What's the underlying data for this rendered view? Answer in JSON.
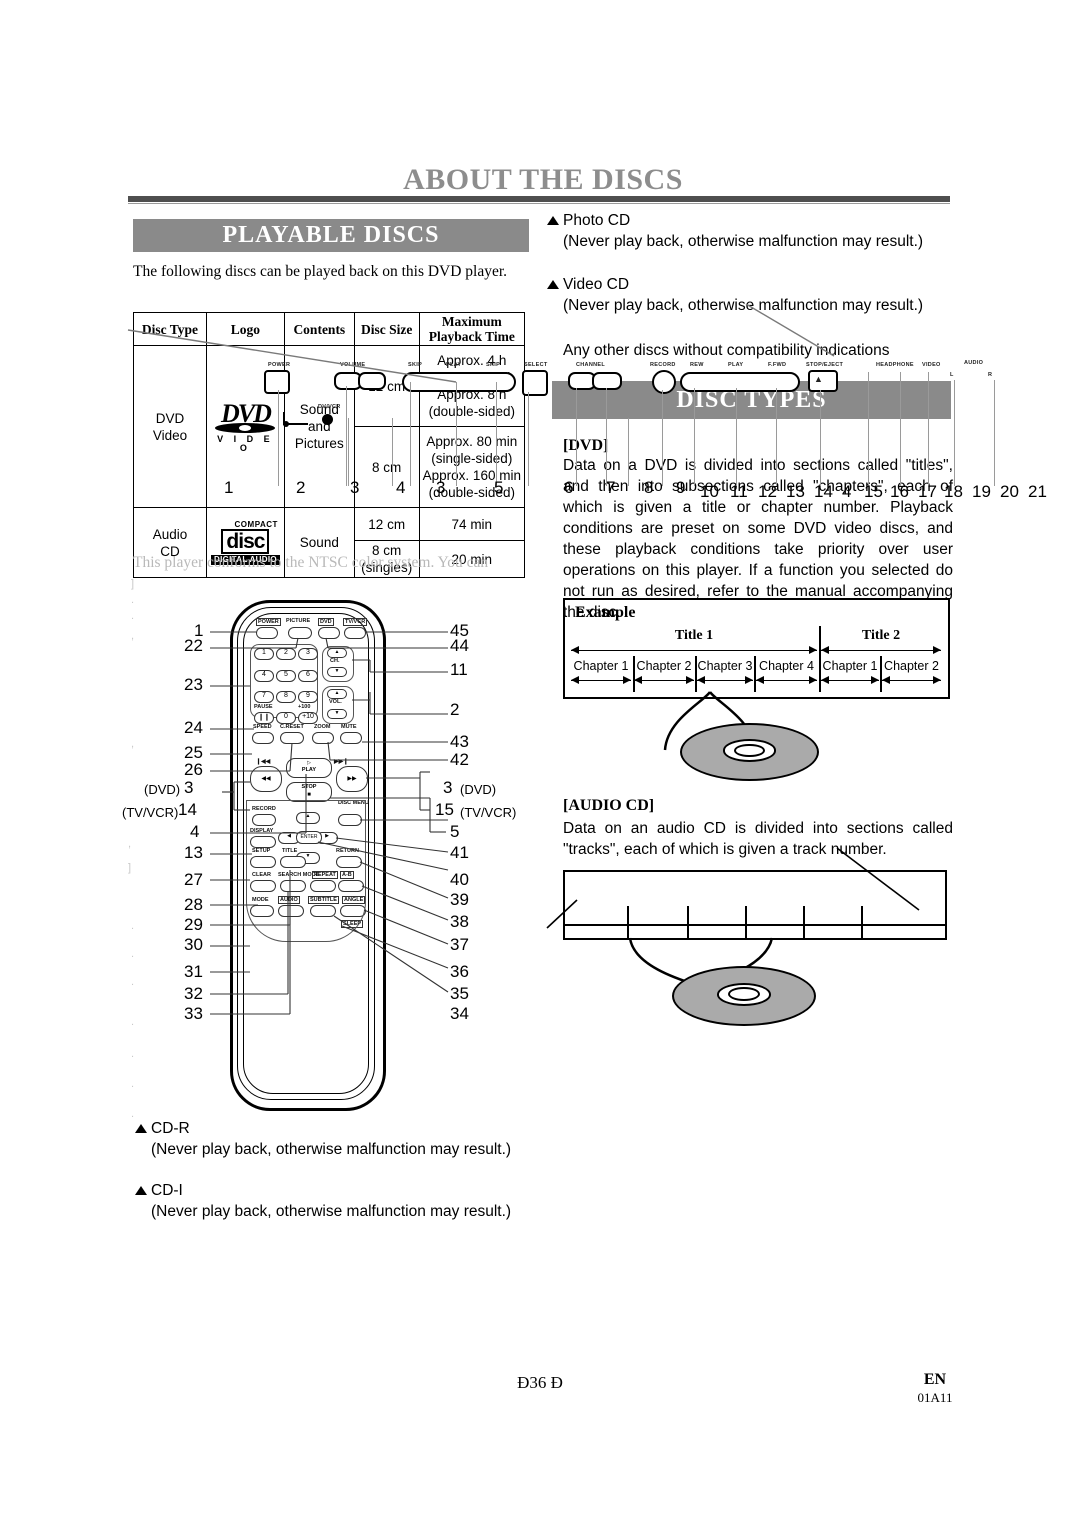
{
  "header": {
    "title": "ABOUT THE DISCS"
  },
  "banners": {
    "playable_discs": "PLAYABLE DISCS",
    "disc_types": "DISC TYPES"
  },
  "left": {
    "intro": "The following discs can be played back on this DVD player.",
    "table": {
      "columns": [
        "Disc Type",
        "Logo",
        "Contents",
        "Disc Size",
        "Maximum Playback Time"
      ],
      "column_maximum_line1": "Maximum",
      "column_maximum_line2": "Playback Time",
      "rows": [
        {
          "disc_type": "DVD Video",
          "logo": "dvd-video-logo",
          "logo_text_main": "DVD",
          "logo_text_sub": "V I D E O",
          "contents": "Sound and Pictures",
          "sizes": [
            {
              "size": "12 cm",
              "time": "Approx. 4 h (single-sided) Approx. 8 h (double-sided)"
            },
            {
              "size": "8 cm",
              "time": "Approx. 80 min (single-sided) Approx. 160 min (double-sided)"
            }
          ]
        },
        {
          "disc_type": "Audio CD",
          "logo": "compact-disc-digital-audio-logo",
          "logo_text_top": "COMPACT",
          "logo_text_main": "disc",
          "logo_text_bottom": "DIGITAL AUDIO",
          "contents": "Sound",
          "sizes": [
            {
              "size": "12 cm",
              "time": "74 min"
            },
            {
              "size": "8 cm (singles)",
              "time": "20 min"
            }
          ]
        }
      ]
    },
    "ntsc_note": "This player conforms to the NTSC color system. You can",
    "cdr": {
      "heading": "CD-R",
      "body": "(Never play back, otherwise malfunction may result.)"
    },
    "cdi": {
      "heading": "CD-I",
      "body": "(Never play back, otherwise malfunction may result.)"
    }
  },
  "right": {
    "photo_cd": {
      "heading": "Photo CD",
      "body": "(Never play back, otherwise malfunction may result.)"
    },
    "video_cd": {
      "heading": "Video CD",
      "body": "(Never play back, otherwise malfunction may result.)"
    },
    "any_other": "Any other discs without compatibility indications",
    "dvd": {
      "heading": "[DVD]",
      "body": "Data on a DVD is divided into sections called \"titles\", and then into subsections called \"chapters\", each of which is given a title or chapter number. Playback conditions are preset on some DVD video discs, and these playback conditions take priority over user operations on this player. If a function you selected do not run as desired, refer to the manual accompanying the disc."
    },
    "example": {
      "label": "Example",
      "titles": [
        {
          "name": "Title 1",
          "chapters": [
            "Chapter 1",
            "Chapter 2",
            "Chapter 3",
            "Chapter 4"
          ]
        },
        {
          "name": "Title 2",
          "chapters": [
            "Chapter 1",
            "Chapter 2"
          ]
        }
      ]
    },
    "audio_cd": {
      "heading": "[AUDIO CD]",
      "body": "Data on an audio CD is divided into sections called \"tracks\", each of which is given a track number."
    }
  },
  "footer": {
    "page": "Ð36 Ð",
    "lang": "EN",
    "code": "01A11"
  },
  "panel_overlay": {
    "labels": [
      "POWER",
      "VOLUME",
      "SKIP",
      "PLAY",
      "SKIP",
      "SELECT",
      "CHANNEL",
      "RECORD",
      "REW",
      "PLAY",
      "F.FWD",
      "STOP/EJECT",
      "HEADPHONE",
      "VIDEO",
      "AUDIO",
      "L",
      "R",
      "DV/VCR"
    ],
    "callout_numbers": [
      "1",
      "2",
      "3",
      "4",
      "3",
      "5",
      "6",
      "7",
      "8",
      "9",
      "10",
      "11",
      "12",
      "13",
      "14",
      "4",
      "15",
      "16",
      "17",
      "18",
      "19",
      "20",
      "21"
    ]
  },
  "remote_overlay": {
    "keys_top": [
      "POWER",
      "PICTURE",
      "DVD",
      "TV/VCR"
    ],
    "numeric_keys": [
      "1",
      "2",
      "3",
      "4",
      "5",
      "6",
      "7",
      "8",
      "9",
      "0",
      "+10"
    ],
    "numeric_extra": "+100",
    "keys": [
      "PAUSE",
      "SPEED",
      "C.RESET",
      "ZOOM",
      "MUTE",
      "PLAY",
      "STOP",
      "RECORD",
      "DISC MENU",
      "DISPLAY",
      "ENTER",
      "SETUP",
      "TITLE",
      "RETURN",
      "CLEAR",
      "SEARCH MODE",
      "REPEAT",
      "A-B",
      "MODE",
      "AUDIO",
      "SUBTITLE",
      "ANGLE",
      "SLEEP"
    ],
    "ch_label": "CH.",
    "vol_label": "VOL.",
    "left_numbers": [
      "1",
      "22",
      "23",
      "24",
      "25",
      "26",
      "3",
      "14",
      "4",
      "13",
      "27",
      "28",
      "29",
      "30",
      "31",
      "32",
      "33"
    ],
    "left_number_tags": [
      "(DVD)",
      "(TV/VCR)"
    ],
    "right_numbers": [
      "45",
      "44",
      "11",
      "2",
      "43",
      "42",
      "3",
      "15",
      "5",
      "41",
      "40",
      "39",
      "38",
      "37",
      "36",
      "35",
      "34"
    ],
    "right_number_tags": [
      "(DVD)",
      "(TV/VCR)"
    ]
  }
}
